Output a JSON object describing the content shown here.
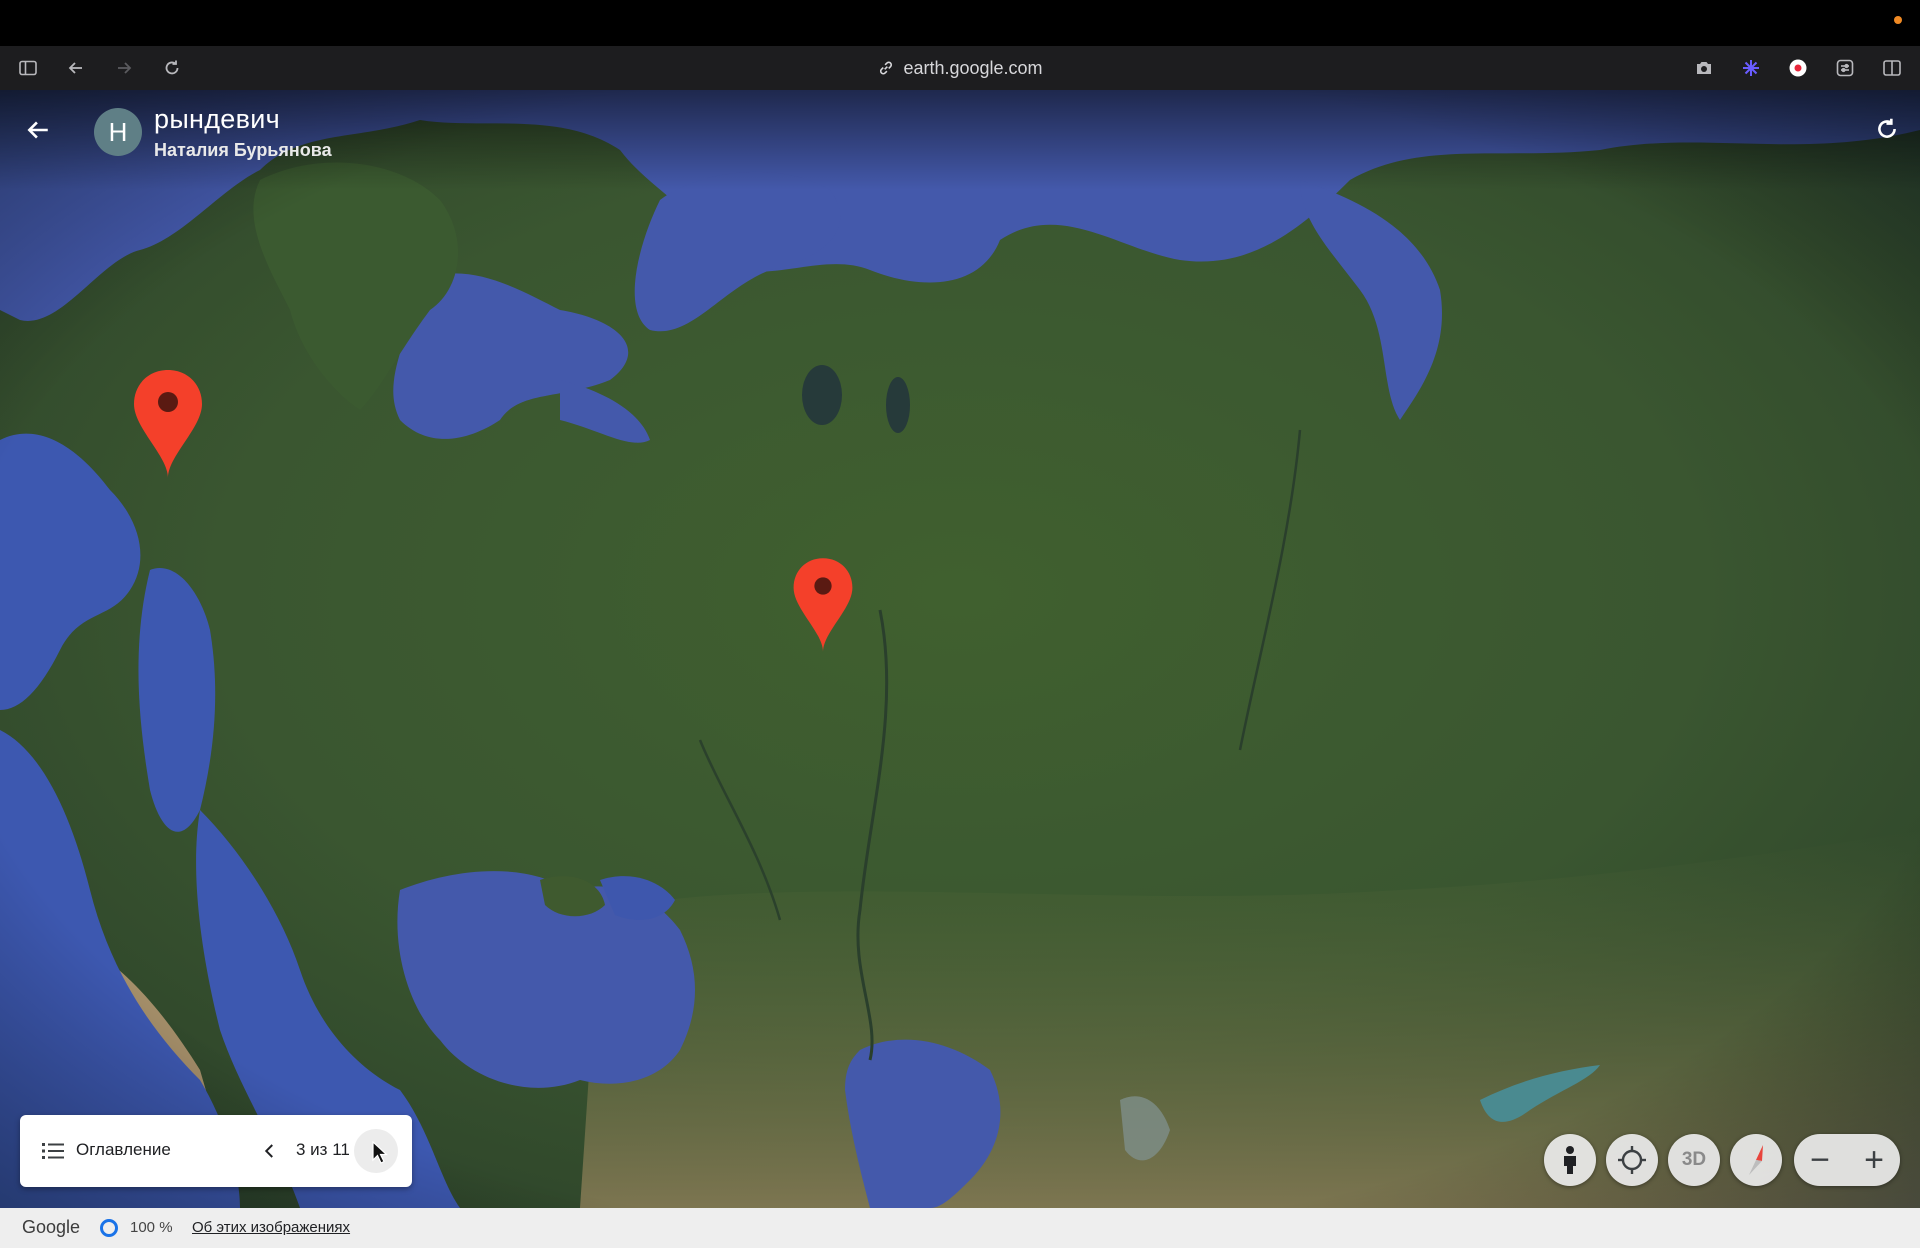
{
  "browser": {
    "url": "earth.google.com",
    "icons": [
      "sidebar-icon",
      "back-arrow-icon",
      "forward-arrow-icon",
      "reload-icon",
      "link-icon",
      "camera-icon",
      "sparkle-icon",
      "record-icon",
      "settings-panel-icon",
      "split-view-icon"
    ]
  },
  "project": {
    "avatar_letter": "Н",
    "title": "рындевич",
    "author": "Наталия Бурьянова"
  },
  "navigator": {
    "toc_label": "Оглавление",
    "counter": "3 из 11"
  },
  "controls": {
    "three_d_label": "3D",
    "zoom_out_label": "−",
    "zoom_in_label": "+"
  },
  "status": {
    "brand": "Google",
    "load_percent": "100 %",
    "about_link": "Об этих изображениях"
  },
  "colors": {
    "pin": "#f4402a",
    "water": "#4459ab",
    "land": "#3d5a2d",
    "load_ring": "#1a73e8"
  }
}
